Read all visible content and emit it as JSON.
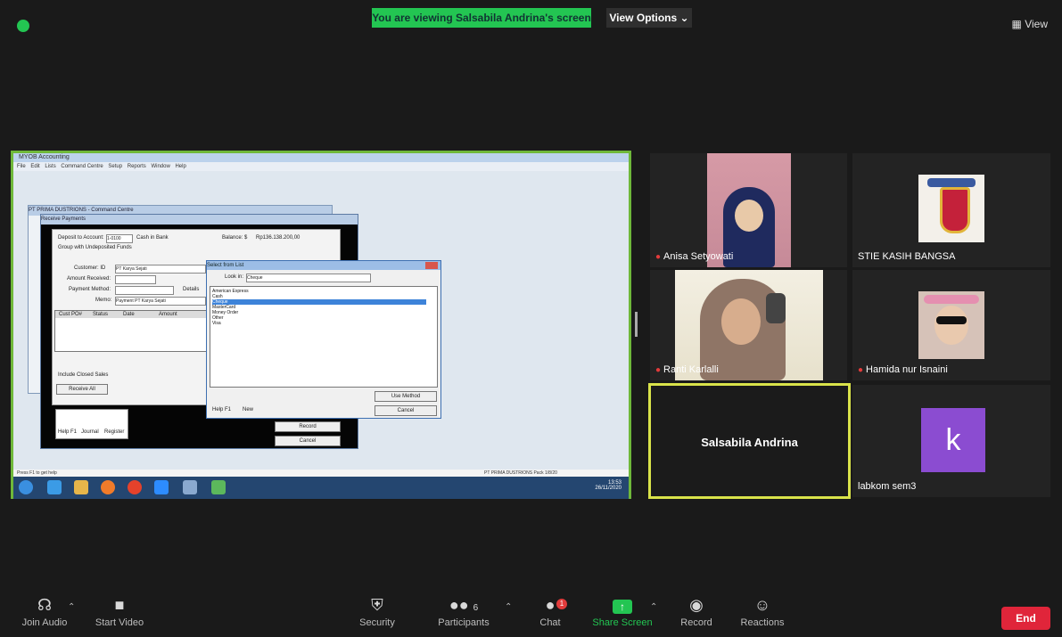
{
  "top": {
    "banner": "You are viewing Salsabila Andrina's screen",
    "view_options": "View Options",
    "view_options_caret": "⌄",
    "view_label": "View"
  },
  "shared_screen": {
    "window_title": "MYOB Accounting",
    "menu": [
      "File",
      "Edit",
      "Lists",
      "Command Centre",
      "Setup",
      "Reports",
      "Window",
      "Help"
    ],
    "command_centre_title": "PT PRIMA DUSTRIONS - Command Centre",
    "receive_title": "Receive Payments",
    "deposit_label": "Deposit to Account:",
    "deposit_account": "1-0100",
    "deposit_name": "Cash in Bank",
    "undeposited_label": "Group with Undeposited Funds",
    "balance_label": "Balance: $",
    "balance_value": "Rp136.138.200,00",
    "customer_label": "Customer: ID",
    "customer_value": "PT Karya Sejati",
    "amount_label": "Amount Received:",
    "method_label": "Payment Method:",
    "details_label": "Details",
    "memo_label": "Memo:",
    "memo_value": "Payment PT Karya Sejati",
    "grid_headers": [
      "Cust PO#",
      "Status",
      "Date",
      "Amount"
    ],
    "include_closed": "Include Closed Sales",
    "receive_all": "Receive All",
    "help_label": "Help F1",
    "journal_label": "Journal",
    "register_label": "Register",
    "record_label": "Record",
    "cancel_label": "Cancel",
    "dialog": {
      "title": "Select from List",
      "look_in_label": "Look in:",
      "look_in_value": "Cheque",
      "items": [
        "American Express",
        "Cash",
        "Cheque",
        "MasterCard",
        "Money Order",
        "Other",
        "Visa"
      ],
      "selected_index": 2,
      "use_method": "Use Method",
      "cancel": "Cancel",
      "help": "Help F1",
      "new": "New"
    },
    "status_left": "Press F1 to get help",
    "status_right": "PT PRIMA DUSTRIONS Pack 1/8/20",
    "clock_time": "13:53",
    "clock_date": "26/11/2020"
  },
  "participants": [
    {
      "name": "Anisa Setyowati",
      "muted": true
    },
    {
      "name": "STIE KASIH BANGSA",
      "muted": false
    },
    {
      "name": "Ranti Karlalli",
      "muted": true
    },
    {
      "name": "Hamida nur Isnaini",
      "muted": true
    },
    {
      "name": "Salsabila Andrina",
      "muted": false
    },
    {
      "name": "labkom sem3",
      "muted": false,
      "avatar_letter": "k"
    }
  ],
  "toolbar": {
    "join_audio": "Join Audio",
    "start_video": "Start Video",
    "security": "Security",
    "participants": "Participants",
    "participants_count": "6",
    "chat": "Chat",
    "chat_badge": "1",
    "share_screen": "Share Screen",
    "record": "Record",
    "reactions": "Reactions",
    "end": "End"
  },
  "colors": {
    "accent_green": "#23c552",
    "end_red": "#e0253a",
    "active_speaker": "#d9e34a",
    "avatar_purple": "#8b4cd1"
  }
}
